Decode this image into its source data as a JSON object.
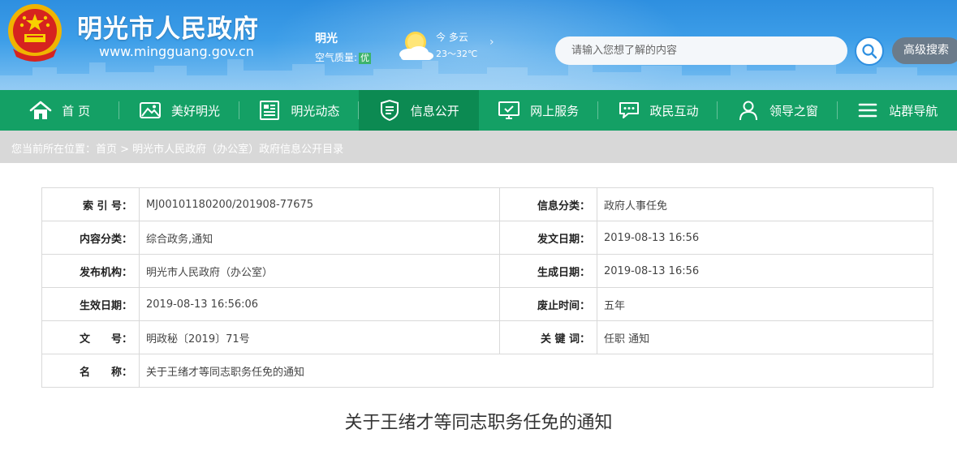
{
  "header": {
    "site_title": "明光市人民政府",
    "site_url": "www.mingguang.gov.cn",
    "city": "明光",
    "aqi_label": "空气质量:",
    "aqi_value": "优",
    "weather_desc": "今 多云",
    "weather_temp": "23～32℃",
    "weather_more": "›",
    "search_placeholder": "请输入您想了解的内容",
    "adv_search_label": "高级搜索",
    "colors": {
      "header_blue": "#2e8fe0",
      "nav_green": "#14a065",
      "nav_active": "#0c8a52"
    },
    "icons": [
      "national-emblem-icon",
      "weather-sun-cloud-icon",
      "search-icon"
    ]
  },
  "nav": {
    "items": [
      {
        "label": "首 页",
        "icon": "home-icon"
      },
      {
        "label": "美好明光",
        "icon": "landscape-icon"
      },
      {
        "label": "明光动态",
        "icon": "news-icon"
      },
      {
        "label": "信息公开",
        "icon": "shield-list-icon"
      },
      {
        "label": "网上服务",
        "icon": "monitor-icon"
      },
      {
        "label": "政民互动",
        "icon": "chat-icon"
      },
      {
        "label": "领导之窗",
        "icon": "person-icon"
      },
      {
        "label": "站群导航",
        "icon": "menu-icon"
      }
    ],
    "active_index": 3
  },
  "breadcrumb": "您当前所在位置：首页 > 明光市人民政府（办公室）政府信息公开目录",
  "info_table": {
    "rows": [
      {
        "label1": "索 引 号：",
        "value1": "MJ00101180200/201908-77675",
        "label2": "信息分类：",
        "value2": "政府人事任免"
      },
      {
        "label1": "内容分类：",
        "value1": "综合政务,通知",
        "label2": "发文日期：",
        "value2": "2019-08-13 16:56"
      },
      {
        "label1": "发布机构：",
        "value1": "明光市人民政府（办公室）",
        "label2": "生成日期：",
        "value2": "2019-08-13 16:56"
      },
      {
        "label1": "生效日期：",
        "value1": "2019-08-13 16:56:06",
        "label2": "废止时间：",
        "value2": "五年"
      },
      {
        "label1": "文　　号：",
        "value1": "明政秘〔2019〕71号",
        "label2": "关 键 词：",
        "value2": "任职 通知"
      },
      {
        "label1": "名　　称：",
        "value1": "关于王绪才等同志职务任免的通知"
      }
    ]
  },
  "document_title": "关于王绪才等同志职务任免的通知"
}
